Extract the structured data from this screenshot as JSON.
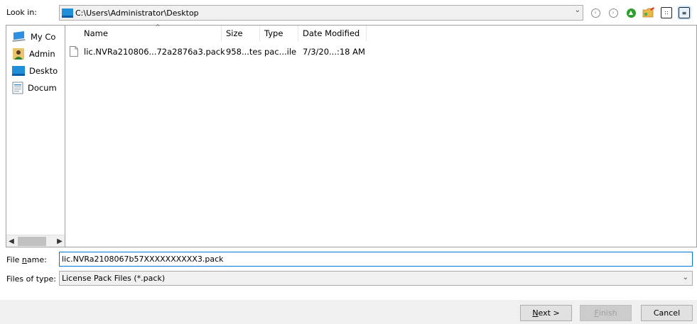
{
  "look_in": {
    "label": "Look in:",
    "path": "C:\\Users\\Administrator\\Desktop"
  },
  "toolbar": {
    "icons": [
      "back-icon",
      "forward-icon",
      "up-folder-icon",
      "new-folder-icon",
      "list-view-icon",
      "details-view-icon"
    ]
  },
  "sidebar": {
    "items": [
      {
        "label": "My Co",
        "icon": "computer-icon"
      },
      {
        "label": "Admin",
        "icon": "user-icon"
      },
      {
        "label": "Deskto",
        "icon": "desktop-icon"
      },
      {
        "label": "Docum",
        "icon": "documents-icon"
      }
    ]
  },
  "file_list": {
    "columns": [
      "Name",
      "Size",
      "Type",
      "Date Modified"
    ],
    "rows": [
      {
        "name": "lic.NVRa210806...72a2876a3.pack",
        "size": "958...tes",
        "type": "pac...ile",
        "date": "7/3/20...:18 AM"
      }
    ]
  },
  "file_name": {
    "label_pre": "File ",
    "label_u": "n",
    "label_post": "ame:",
    "value": "lic.NVRa2108067b57XXXXXXXXXX3.pack"
  },
  "file_type": {
    "label": "Files of type:",
    "value": "License Pack Files (*.pack)"
  },
  "buttons": {
    "next_u": "N",
    "next_rest": "ext >",
    "finish_u": "F",
    "finish_rest": "inish",
    "cancel": "Cancel"
  },
  "colors": {
    "accent": "#0078d7",
    "bar": "#f0f0f0"
  }
}
